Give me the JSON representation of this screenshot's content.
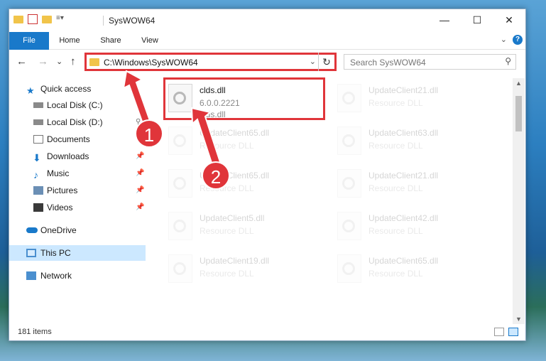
{
  "window": {
    "title": "SysWOW64",
    "controls": {
      "minimize": "—",
      "maximize": "☐",
      "close": "✕"
    }
  },
  "ribbon": {
    "tabs": [
      "File",
      "Home",
      "Share",
      "View"
    ],
    "help": "?"
  },
  "navbar": {
    "back": "←",
    "forward": "→",
    "recent": "⌄",
    "up": "↑",
    "address": "C:\\Windows\\SysWOW64",
    "search_placeholder": "Search SysWOW64"
  },
  "sidebar": {
    "items": [
      {
        "label": "Quick access",
        "icon": "star-icon"
      },
      {
        "label": "Local Disk (C:)",
        "icon": "drive-icon"
      },
      {
        "label": "Local Disk (D:)",
        "icon": "drive-icon"
      },
      {
        "label": "Documents",
        "icon": "documents-icon"
      },
      {
        "label": "Downloads",
        "icon": "download-icon"
      },
      {
        "label": "Music",
        "icon": "music-icon"
      },
      {
        "label": "Pictures",
        "icon": "pictures-icon"
      },
      {
        "label": "Videos",
        "icon": "videos-icon"
      },
      {
        "label": "OneDrive",
        "icon": "cloud-icon"
      },
      {
        "label": "This PC",
        "icon": "computer-icon"
      },
      {
        "label": "Network",
        "icon": "network-icon"
      }
    ]
  },
  "files": [
    {
      "name": "clds.dll",
      "line2": "6.0.0.2221",
      "line3": "clds.dll"
    },
    {
      "name": "UpdateClient21.dll",
      "line2": "Resource DLL"
    },
    {
      "name": "UpdateClient65.dll",
      "line2": "Resource DLL"
    },
    {
      "name": "UpdateClient63.dll",
      "line2": "Resource DLL"
    },
    {
      "name": "UpdateClient65.dll",
      "line2": "Resource DLL"
    },
    {
      "name": "UpdateClient21.dll",
      "line2": "Resource DLL"
    },
    {
      "name": "UpdateClient5.dll",
      "line2": "Resource DLL"
    },
    {
      "name": "UpdateClient42.dll",
      "line2": "Resource DLL"
    },
    {
      "name": "UpdateClient19.dll",
      "line2": "Resource DLL"
    },
    {
      "name": "UpdateClient65.dll",
      "line2": "Resource DLL"
    }
  ],
  "status": {
    "count": "181 items"
  },
  "annotations": {
    "badge1": "1",
    "badge2": "2"
  },
  "colors": {
    "accent": "#1979ca",
    "highlight": "#e0353a",
    "selected": "#cce8ff"
  }
}
